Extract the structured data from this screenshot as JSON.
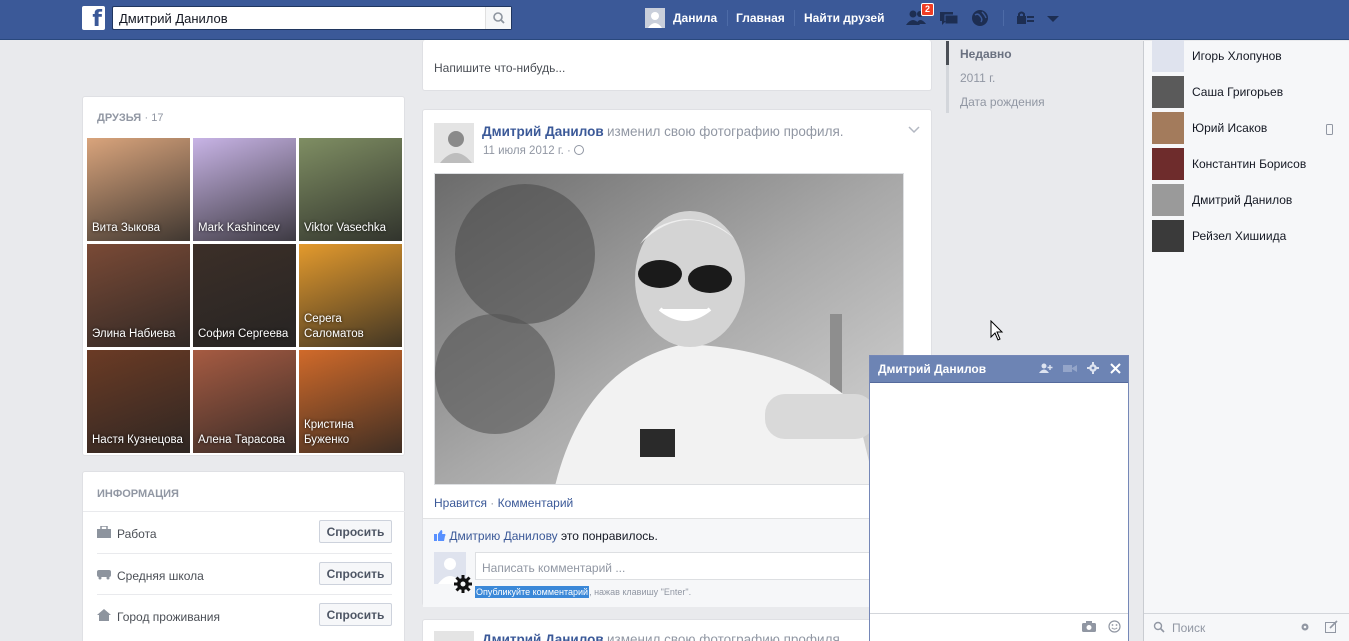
{
  "topbar": {
    "search_value": "Дмитрий Данилов",
    "user_name": "Данила",
    "home": "Главная",
    "find_friends": "Найти друзей",
    "friend_requests_count": "2"
  },
  "composer": {
    "placeholder": "Напишите что-нибудь..."
  },
  "friends": {
    "title": "Друзья",
    "count": "· 17",
    "tiles": [
      {
        "name": "Вита Зыкова",
        "color": "#d9a47c"
      },
      {
        "name": "Mark Kashincev",
        "color": "#c8b4e6"
      },
      {
        "name": "Viktor Vasechka",
        "color": "#7f8e63"
      },
      {
        "name": "Элина Набиева",
        "color": "#7a4a36"
      },
      {
        "name": "София Сергеева",
        "color": "#3c2f28"
      },
      {
        "name": "Серега Саломатов",
        "color": "#e39a2d"
      },
      {
        "name": "Настя Кузнецова",
        "color": "#6b3b25"
      },
      {
        "name": "Алена Тарасова",
        "color": "#a65b42"
      },
      {
        "name": "Кристина Буженко",
        "color": "#d06a2a"
      }
    ]
  },
  "info": {
    "title": "Информация",
    "rows": [
      {
        "label": "Работа",
        "button": "Спросить"
      },
      {
        "label": "Средняя школа",
        "button": "Спросить"
      },
      {
        "label": "Город проживания",
        "button": "Спросить"
      }
    ]
  },
  "post": {
    "author": "Дмитрий Данилов",
    "action": "изменил свою фотографию профиля.",
    "date": "11 июля 2012 г. ·",
    "like": "Нравится",
    "dot": "·",
    "comment": "Комментарий",
    "liked_by": "Дмитрию Данилову",
    "liked_suffix": "это понравилось.",
    "comment_placeholder": "Написать комментарий ...",
    "hint_highlight": "Опубликуйте комментарий",
    "hint_rest": ", нажав клавишу \"Enter\"."
  },
  "post2": {
    "author": "Дмитрий Данилов",
    "action": "изменил свою фотографию профиля."
  },
  "timeline_nav": [
    "Недавно",
    "2011 г.",
    "Дата рождения"
  ],
  "chat_buddies": [
    {
      "name": "Игорь Хлопунов",
      "color": "#dfe3ee"
    },
    {
      "name": "Саша Григорьев",
      "color": "#5a5a5a"
    },
    {
      "name": "Юрий Исаков",
      "color": "#a37b5c"
    },
    {
      "name": "Константин Борисов",
      "color": "#6e2c2c"
    },
    {
      "name": "Дмитрий Данилов",
      "color": "#9a9a9a"
    },
    {
      "name": "Рейзел Хишиида",
      "color": "#3a3a3a"
    }
  ],
  "sidebar_search": {
    "placeholder": "Поиск"
  },
  "chat_window": {
    "title": "Дмитрий Данилов"
  }
}
